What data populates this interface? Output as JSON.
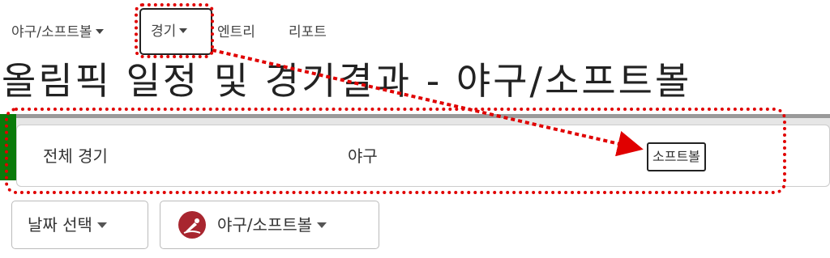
{
  "nav": {
    "items": [
      {
        "label": "야구/소프트볼"
      },
      {
        "label": "경기"
      },
      {
        "label": "엔트리"
      },
      {
        "label": "리포트"
      }
    ]
  },
  "page": {
    "title": "올림픽 일정 및 경기결과 - 야구/소프트볼"
  },
  "tabs": {
    "items": [
      {
        "label": "전체 경기"
      },
      {
        "label": "야구"
      },
      {
        "label": "소프트볼"
      }
    ],
    "selected": "소프트볼"
  },
  "filters": {
    "date_select": "날짜 선택",
    "sport_select": "야구/소프트볼"
  },
  "colors": {
    "annotation": "#e00000",
    "accent_green": "#0a7a0a",
    "sport_icon_bg": "#a8262f"
  },
  "icons": [
    "caret-down-icon",
    "baseball-softball-icon",
    "arrow-annotation"
  ]
}
